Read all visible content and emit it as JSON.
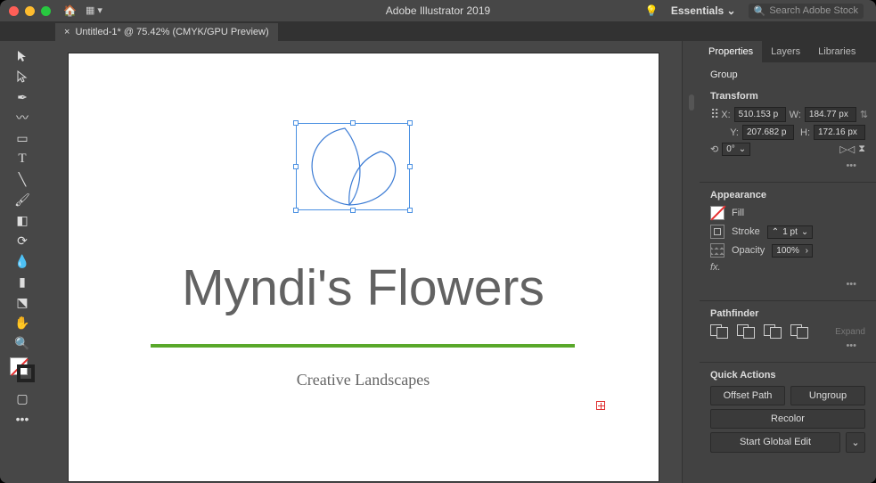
{
  "app_title": "Adobe Illustrator 2019",
  "workspace": "Essentials",
  "search_placeholder": "Search Adobe Stock",
  "document_tab": "Untitled-1* @ 75.42% (CMYK/GPU Preview)",
  "canvas": {
    "title": "Myndi's Flowers",
    "tagline": "Creative Landscapes"
  },
  "panels": {
    "tabs": {
      "properties": "Properties",
      "layers": "Layers",
      "libraries": "Libraries"
    },
    "selection_type": "Group",
    "transform": {
      "label": "Transform",
      "x": "510.153 p",
      "y": "207.682 p",
      "w": "184.77 px",
      "h": "172.16 px",
      "rotate": "0°"
    },
    "appearance": {
      "label": "Appearance",
      "fill": "Fill",
      "stroke": "Stroke",
      "stroke_w": "1 pt",
      "opacity_lbl": "Opacity",
      "opacity": "100%"
    },
    "pathfinder": {
      "label": "Pathfinder",
      "expand": "Expand"
    },
    "quick": {
      "label": "Quick Actions",
      "offset": "Offset Path",
      "ungroup": "Ungroup",
      "recolor": "Recolor",
      "global": "Start Global Edit"
    }
  },
  "colors": {
    "traffic_red": "#ff5f57",
    "traffic_yellow": "#febc2e",
    "traffic_green": "#28c840"
  }
}
